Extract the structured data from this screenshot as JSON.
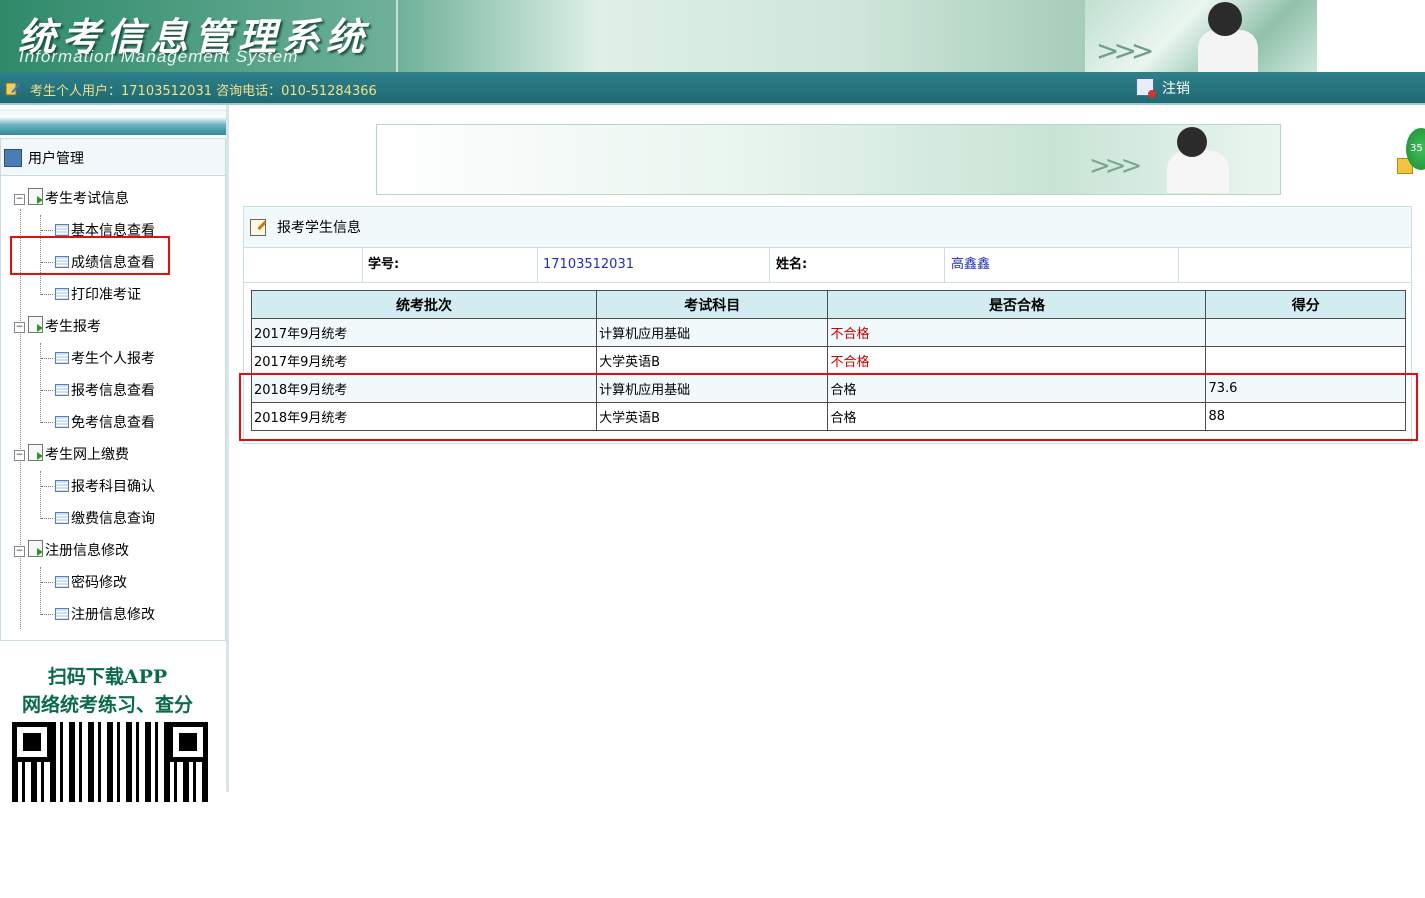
{
  "header": {
    "logo_cn": "统考信息管理系统",
    "logo_en": "Information Management System"
  },
  "userbar": {
    "user_info": "考生个人用户：17103512031 咨询电话：010-51284366",
    "logout_label": "注销"
  },
  "sidebar": {
    "title": "用户管理",
    "groups": [
      {
        "label": "考生考试信息",
        "items": [
          "基本信息查看",
          "成绩信息查看",
          "打印准考证"
        ]
      },
      {
        "label": "考生报考",
        "items": [
          "考生个人报考",
          "报考信息查看",
          "免考信息查看"
        ]
      },
      {
        "label": "考生网上缴费",
        "items": [
          "报考科目确认",
          "缴费信息查询"
        ]
      },
      {
        "label": "注册信息修改",
        "items": [
          "密码修改",
          "注册信息修改"
        ]
      }
    ],
    "qr_line1": "扫码下载APP",
    "qr_line2": "网络统考练习、查分"
  },
  "side_badge": "35",
  "panel": {
    "title": "报考学生信息",
    "student_id_label": "学号:",
    "student_id": "17103512031",
    "name_label": "姓名:",
    "name": "高鑫鑫"
  },
  "table": {
    "headers": [
      "统考批次",
      "考试科目",
      "是否合格",
      "得分"
    ],
    "rows": [
      {
        "batch": "2017年9月统考",
        "subject": "计算机应用基础",
        "status": "不合格",
        "score": ""
      },
      {
        "batch": "2017年9月统考",
        "subject": "大学英语B",
        "status": "不合格",
        "score": ""
      },
      {
        "batch": "2018年9月统考",
        "subject": "计算机应用基础",
        "status": "合格",
        "score": "73.6"
      },
      {
        "batch": "2018年9月统考",
        "subject": "大学英语B",
        "status": "合格",
        "score": "88"
      }
    ]
  },
  "colors": {
    "header_teal": "#1f6a73",
    "user_info_text": "#f2e08a",
    "fail_red": "#cc0000",
    "highlight_red": "#e01010",
    "table_header_bg": "#d3ecf1"
  }
}
